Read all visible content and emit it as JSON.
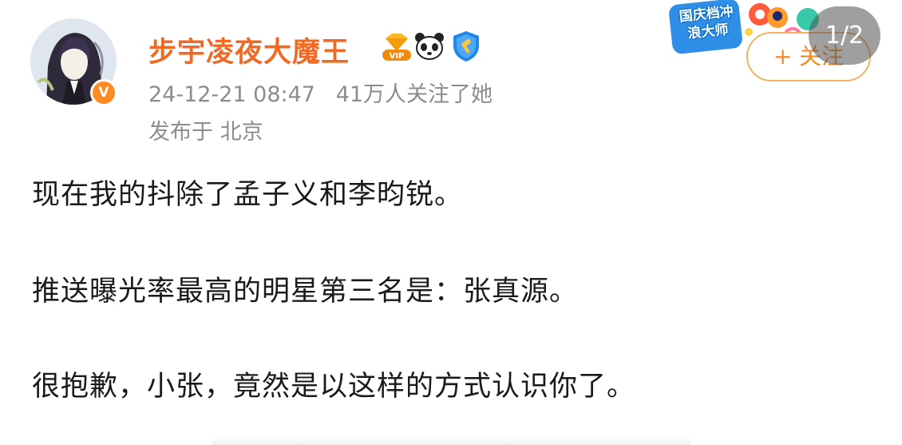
{
  "post": {
    "username": "步宇凌夜大魔王",
    "meta": "24-12-21 08:47   41万人关注了她",
    "location": "发布于 北京",
    "lines": [
      "现在我的抖除了孟子义和李昀锐。",
      "推送曝光率最高的明星第三名是：张真源。",
      "很抱歉，小张，竟然是以这样的方式认识你了。"
    ]
  },
  "header": {
    "follow_label": "+ 关注",
    "pager": "1/2",
    "promo_text": "国庆档冲浪大师"
  },
  "icons": {
    "avatar_badge": "v-verified-icon",
    "vip": "vip-diamond-icon",
    "panda": "panda-icon",
    "shield": "shield-hammer-icon"
  },
  "colors": {
    "username": "#f06a25",
    "follow_border": "#f5b062",
    "meta": "#8c8c8c",
    "body": "#1a1a1a"
  }
}
